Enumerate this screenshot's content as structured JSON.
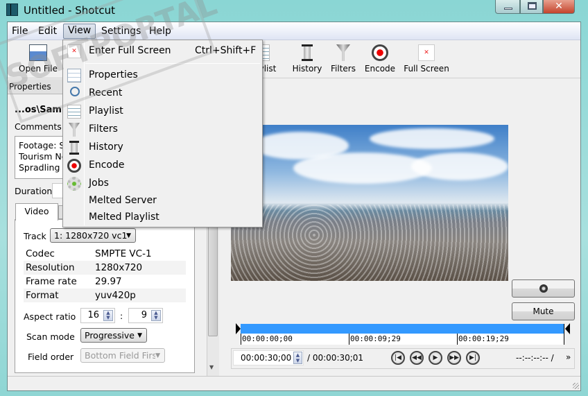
{
  "window": {
    "title": "Untitled - Shotcut",
    "minimize": "minimize",
    "maximize": "maximize",
    "close": "✕"
  },
  "menubar": [
    "File",
    "Edit",
    "View",
    "Settings",
    "Help"
  ],
  "toolbar": {
    "open_file": "Open File",
    "playlist": "Playlist",
    "history": "History",
    "filters": "Filters",
    "encode": "Encode",
    "full_screen": "Full Screen"
  },
  "properties": {
    "dock_title": "Properties",
    "file_name": "...os\\Samp",
    "comments_label": "Comments:",
    "comments_lines": [
      "Footage: S",
      "Tourism Ne",
      "Spradling |"
    ],
    "duration_label": "Duration",
    "tabs": [
      "Video"
    ],
    "track_label": "Track",
    "track_value": "1: 1280x720 vc1",
    "info": [
      [
        "Codec",
        "SMPTE VC-1"
      ],
      [
        "Resolution",
        "1280x720"
      ],
      [
        "Frame rate",
        "29.97"
      ],
      [
        "Format",
        "yuv420p"
      ]
    ],
    "aspect_label": "Aspect ratio",
    "aspect_w": "16",
    "aspect_sep": ":",
    "aspect_h": "9",
    "scan_label": "Scan mode",
    "scan_value": "Progressive",
    "field_label": "Field order",
    "field_value": "Bottom Field First"
  },
  "view_menu": {
    "items": [
      {
        "label": "Enter Full Screen",
        "shortcut": "Ctrl+Shift+F",
        "icon": "fullscreen-icon"
      },
      {
        "label": "Properties",
        "icon": "properties-icon"
      },
      {
        "label": "Recent",
        "icon": "recent-icon"
      },
      {
        "label": "Playlist",
        "icon": "playlist-icon"
      },
      {
        "label": "Filters",
        "icon": "filter-icon"
      },
      {
        "label": "History",
        "icon": "hourglass-icon"
      },
      {
        "label": "Encode",
        "icon": "record-icon"
      },
      {
        "label": "Jobs",
        "icon": "gear-icon"
      },
      {
        "label": "Melted Server"
      },
      {
        "label": "Melted Playlist"
      }
    ]
  },
  "player": {
    "volume_icon": "volume-icon",
    "mute_label": "Mute",
    "ruler_labels": [
      "00:00:00;00",
      "00:00:09;29",
      "00:00:19;29"
    ],
    "position": "00:00:30;00",
    "duration": "/ 00:00:30;01",
    "in_out": "--:--:--:-- /",
    "more": "»"
  },
  "watermark": "SOFTPORTAL"
}
